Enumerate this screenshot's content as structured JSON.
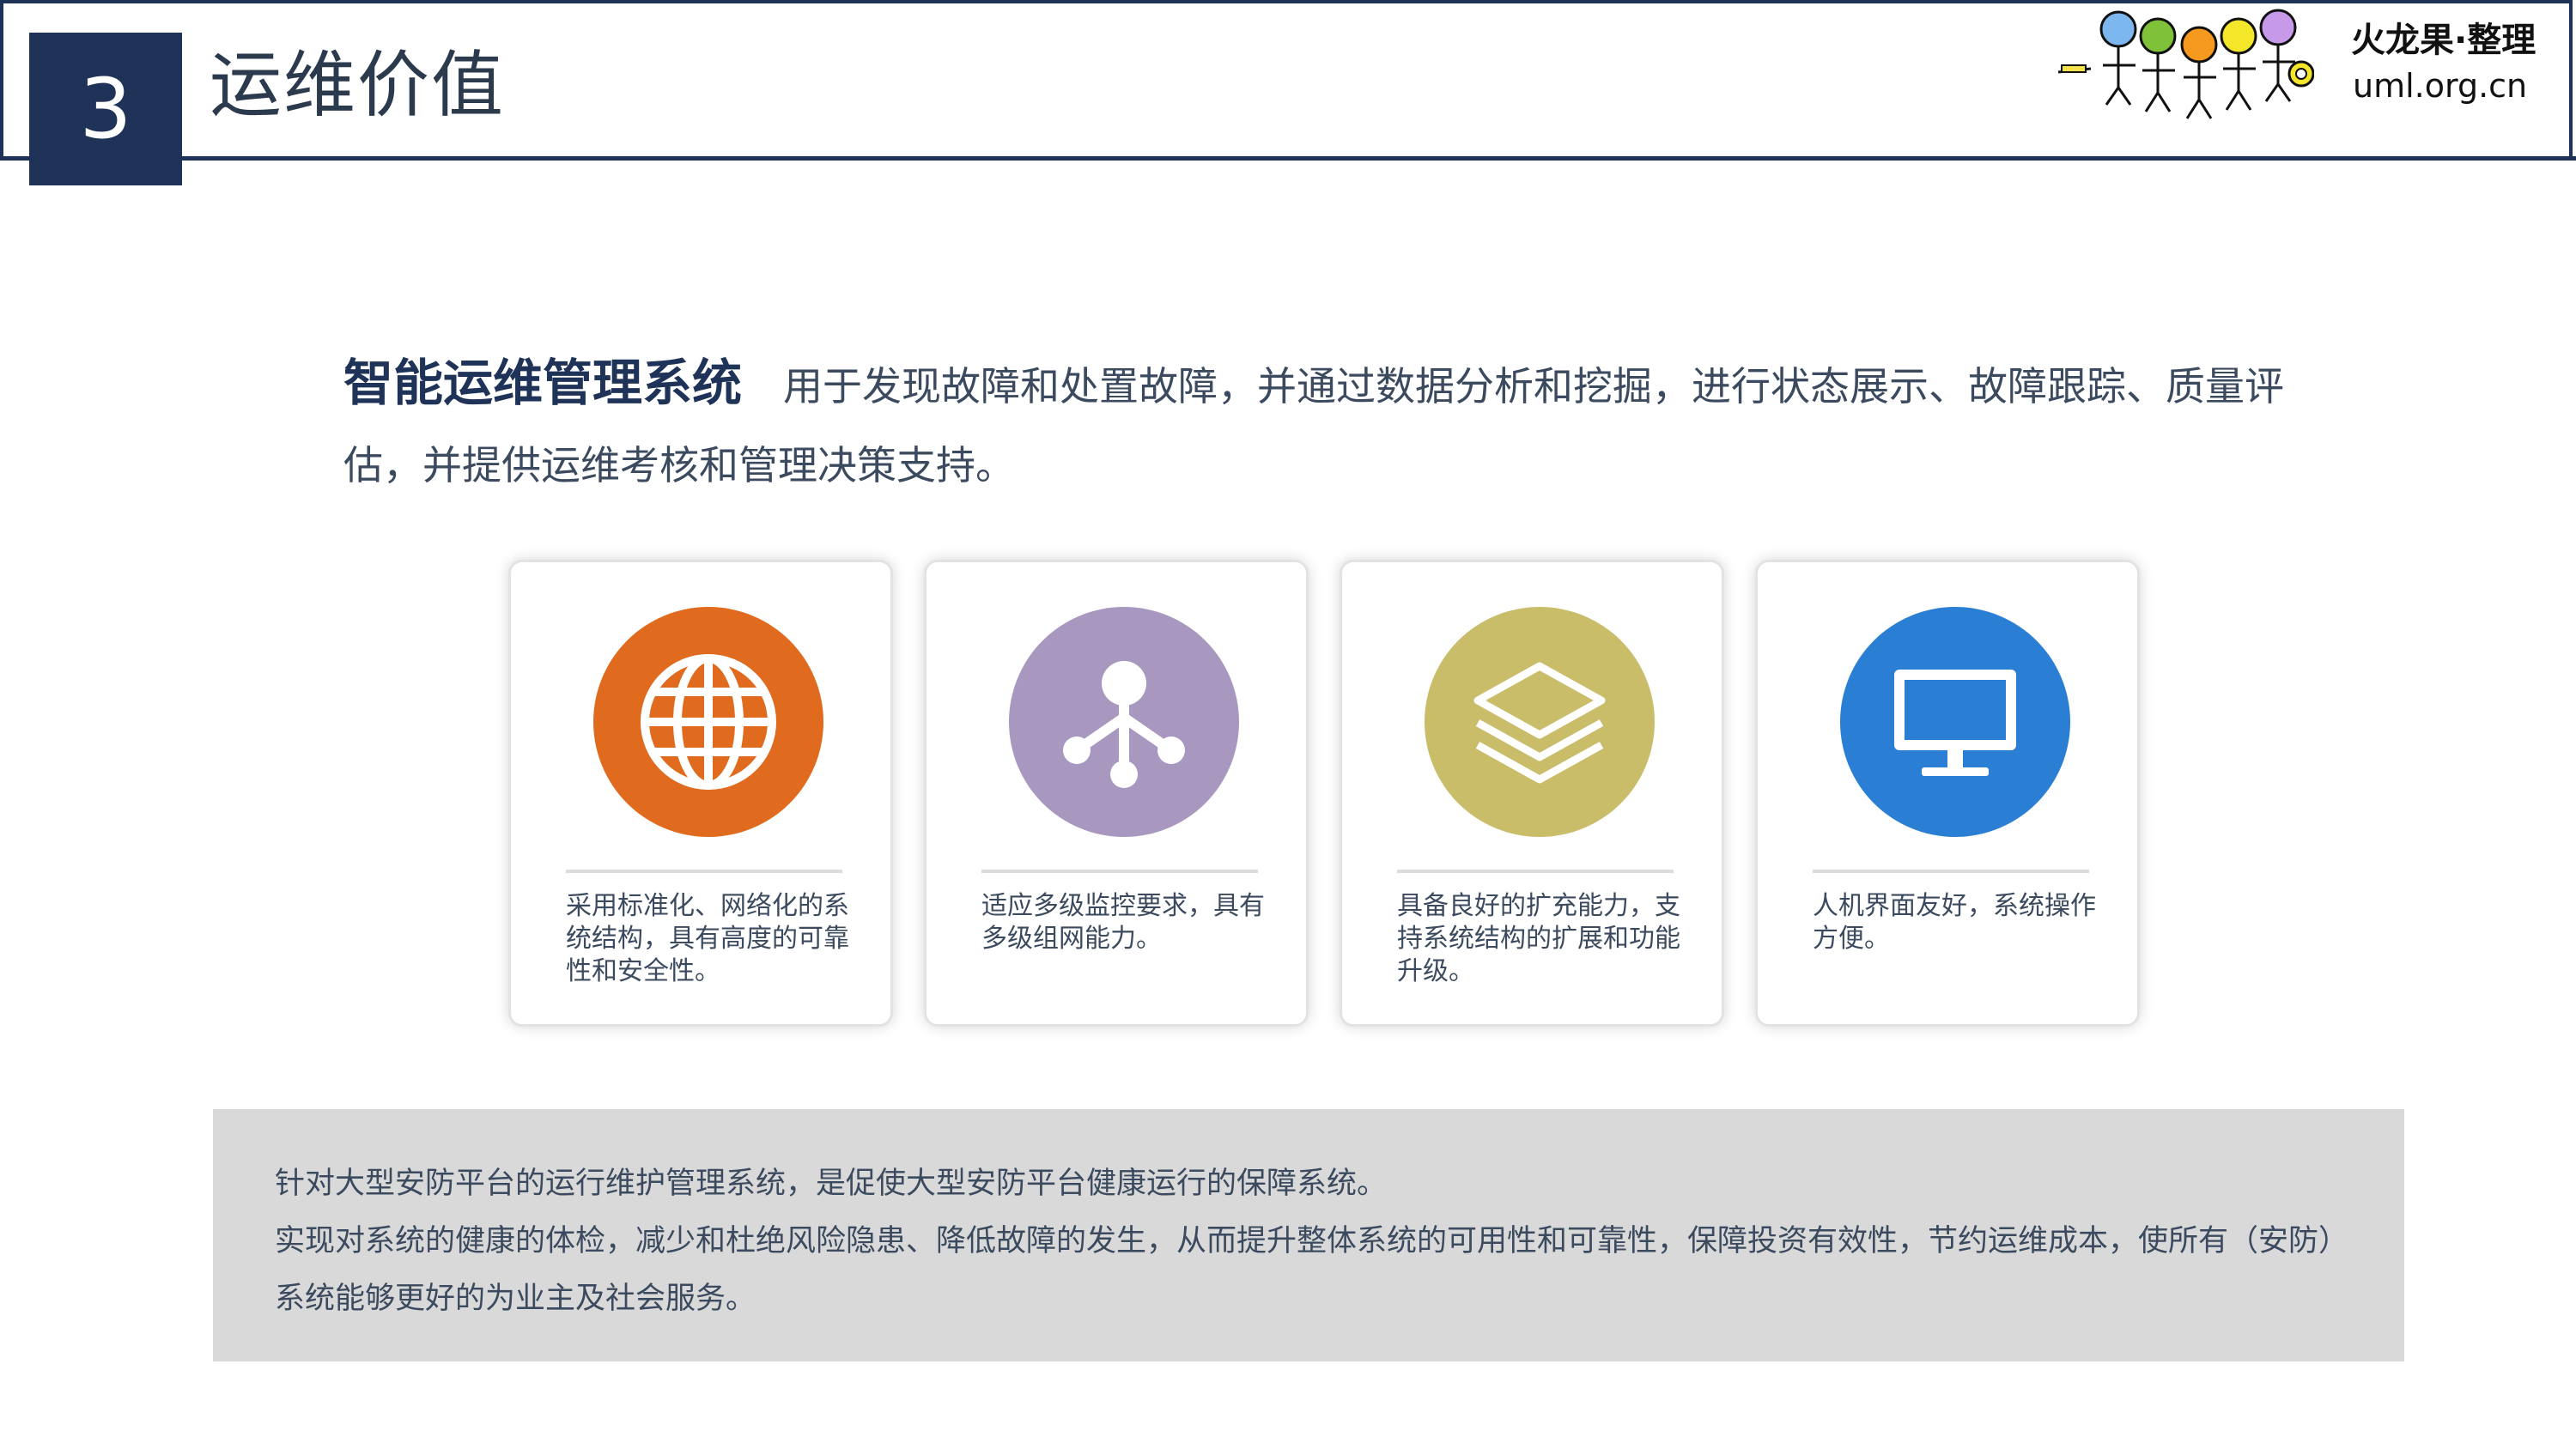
{
  "header": {
    "section_number": "3",
    "title": "运维价值",
    "brand_name": "火龙果·整理",
    "brand_url": "uml.org.cn"
  },
  "intro": {
    "highlight": "智能运维管理系统",
    "text": "用于发现故障和处置故障，并通过数据分析和挖掘，进行状态展示、故障跟踪、质量评估，并提供运维考核和管理决策支持。"
  },
  "cards": [
    {
      "icon": "globe-icon",
      "color": "#e06b1e",
      "text": "采用标准化、网络化的系统结构，具有高度的可靠性和安全性。"
    },
    {
      "icon": "network-icon",
      "color": "#a898c0",
      "text": "适应多级监控要求，具有多级组网能力。"
    },
    {
      "icon": "layers-icon",
      "color": "#c9bd6a",
      "text": "具备良好的扩充能力，支持系统结构的扩展和功能升级。"
    },
    {
      "icon": "monitor-icon",
      "color": "#2a7fd4",
      "text": "人机界面友好，系统操作方便。"
    }
  ],
  "note": {
    "line1": "针对大型安防平台的运行维护管理系统，是促使大型安防平台健康运行的保障系统。",
    "line2": "实现对系统的健康的体检，减少和杜绝风险隐患、降低故障的发生，从而提升整体系统的可用性和可靠性，保障投资有效性，节约运维成本，使所有（安防）系统能够更好的为业主及社会服务。"
  },
  "colors": {
    "navy": "#1f3358",
    "text": "#3b4a5e",
    "note_bg": "#d9d9d9"
  }
}
